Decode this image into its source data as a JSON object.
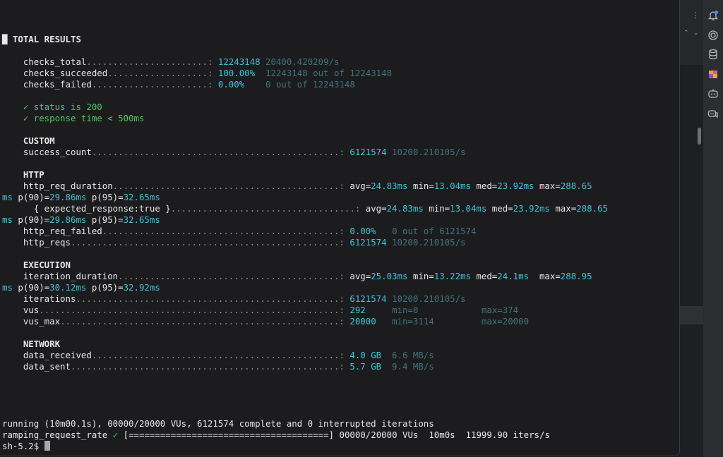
{
  "results": {
    "title": "TOTAL RESULTS",
    "checks_total": {
      "label": "checks_total",
      "value": "12243148",
      "rate": "20400.420209/s"
    },
    "checks_succeeded": {
      "label": "checks_succeeded",
      "value": "100.00%",
      "detail": "12243148 out of 12243148"
    },
    "checks_failed": {
      "label": "checks_failed",
      "value": "0.00%",
      "detail": "0 out of 12243148"
    },
    "check_list": [
      "✓ status is 200",
      "✓ response time < 500ms"
    ]
  },
  "custom": {
    "header": "CUSTOM",
    "success_count": {
      "label": "success_count",
      "value": "6121574",
      "rate": "10200.210105/s"
    }
  },
  "http": {
    "header": "HTTP",
    "duration": {
      "label": "http_req_duration",
      "avg": "24.83ms",
      "min": "13.04ms",
      "med": "23.92ms",
      "max_a": "288.65",
      "max_b": "ms",
      "p90": "29.86ms",
      "p95": "32.65ms"
    },
    "expected": {
      "label": "{ expected_response:true }",
      "avg": "24.83ms",
      "min": "13.04ms",
      "med": "23.92ms",
      "max_a": "288.65",
      "max_b": "ms",
      "p90": "29.86ms",
      "p95": "32.65ms"
    },
    "failed": {
      "label": "http_req_failed",
      "value": "0.00%",
      "detail": "0 out of 6121574"
    },
    "reqs": {
      "label": "http_reqs",
      "value": "6121574",
      "rate": "10200.210105/s"
    }
  },
  "execution": {
    "header": "EXECUTION",
    "iteration_duration": {
      "label": "iteration_duration",
      "avg": "25.03ms",
      "min": "13.22ms",
      "med": "24.1ms",
      "max_a": "288.95",
      "max_b": "ms",
      "p90": "30.12ms",
      "p95": "32.92ms"
    },
    "iterations": {
      "label": "iterations",
      "value": "6121574",
      "rate": "10200.210105/s"
    },
    "vus": {
      "label": "vus",
      "value": "292",
      "min": "min=0",
      "max": "max=374"
    },
    "vus_max": {
      "label": "vus_max",
      "value": "20000",
      "min": "min=3114",
      "max": "max=20000"
    }
  },
  "network": {
    "header": "NETWORK",
    "data_received": {
      "label": "data_received",
      "value": "4.0 GB",
      "rate": "6.6 MB/s"
    },
    "data_sent": {
      "label": "data_sent",
      "value": "5.7 GB",
      "rate": "9.4 MB/s"
    }
  },
  "status": {
    "running": "running (10m00.1s), 00000/20000 VUs, 6121574 complete and 0 interrupted iterations",
    "scenario": "ramping_request_rate",
    "check": "✓",
    "progress": "[======================================]",
    "vus": "00000/20000 VUs",
    "time": "10m0s",
    "rate": "11999.90 iters/s",
    "prompt": "sh-5.2$"
  },
  "icons": {
    "kebab": "more-vert-icon",
    "chevrons": [
      "chevron-up-icon",
      "chevron-down-icon"
    ],
    "toolbar": [
      "notifications-icon",
      "swirl-icon",
      "database-icon",
      "plugin-icon",
      "ai-assistant-icon",
      "ai-chat-icon"
    ]
  }
}
